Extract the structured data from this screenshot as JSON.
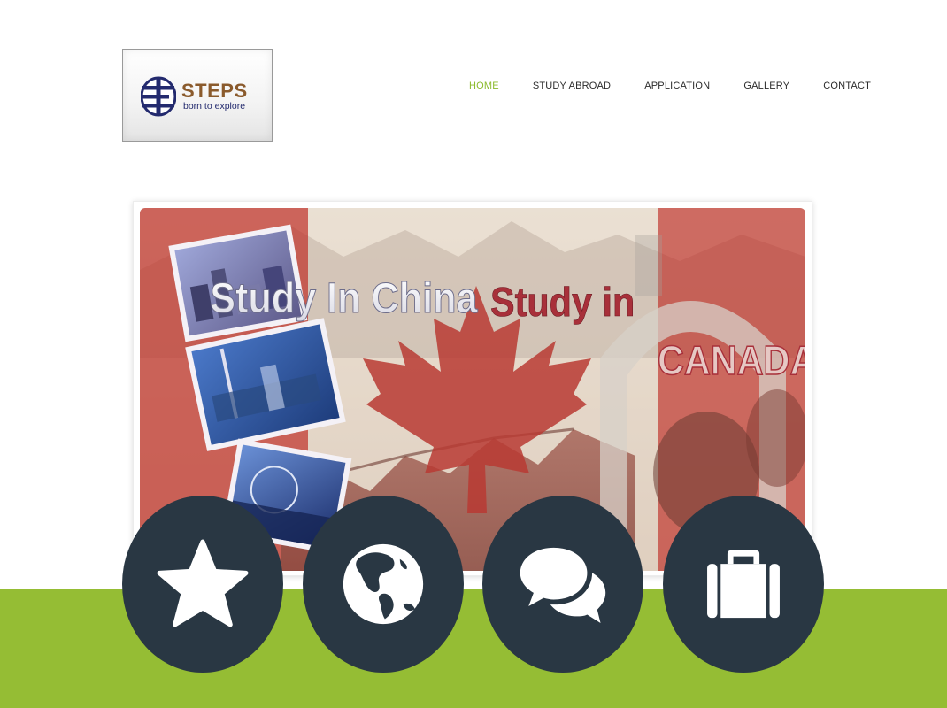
{
  "brand": {
    "name": "STEPS",
    "tagline": "born to explore"
  },
  "nav": {
    "items": [
      {
        "label": "HOME",
        "active": true
      },
      {
        "label": "STUDY ABROAD",
        "active": false
      },
      {
        "label": "APPLICATION",
        "active": false
      },
      {
        "label": "GALLERY",
        "active": false
      },
      {
        "label": "CONTACT",
        "active": false
      }
    ]
  },
  "hero": {
    "text_china": "Study In China",
    "text_canada_line1": "Study in",
    "text_canada_line2": "CANADA"
  },
  "features": [
    {
      "icon": "star-icon"
    },
    {
      "icon": "globe-icon"
    },
    {
      "icon": "chat-bubbles-icon"
    },
    {
      "icon": "briefcase-icon"
    }
  ],
  "colors": {
    "nav_active": "#8cbb2c",
    "nav_text": "#2b2b2b",
    "band_green": "#95bd34",
    "circle_dark": "#293743",
    "brand_brown": "#8a5a2c",
    "brand_navy": "#232a6e"
  }
}
